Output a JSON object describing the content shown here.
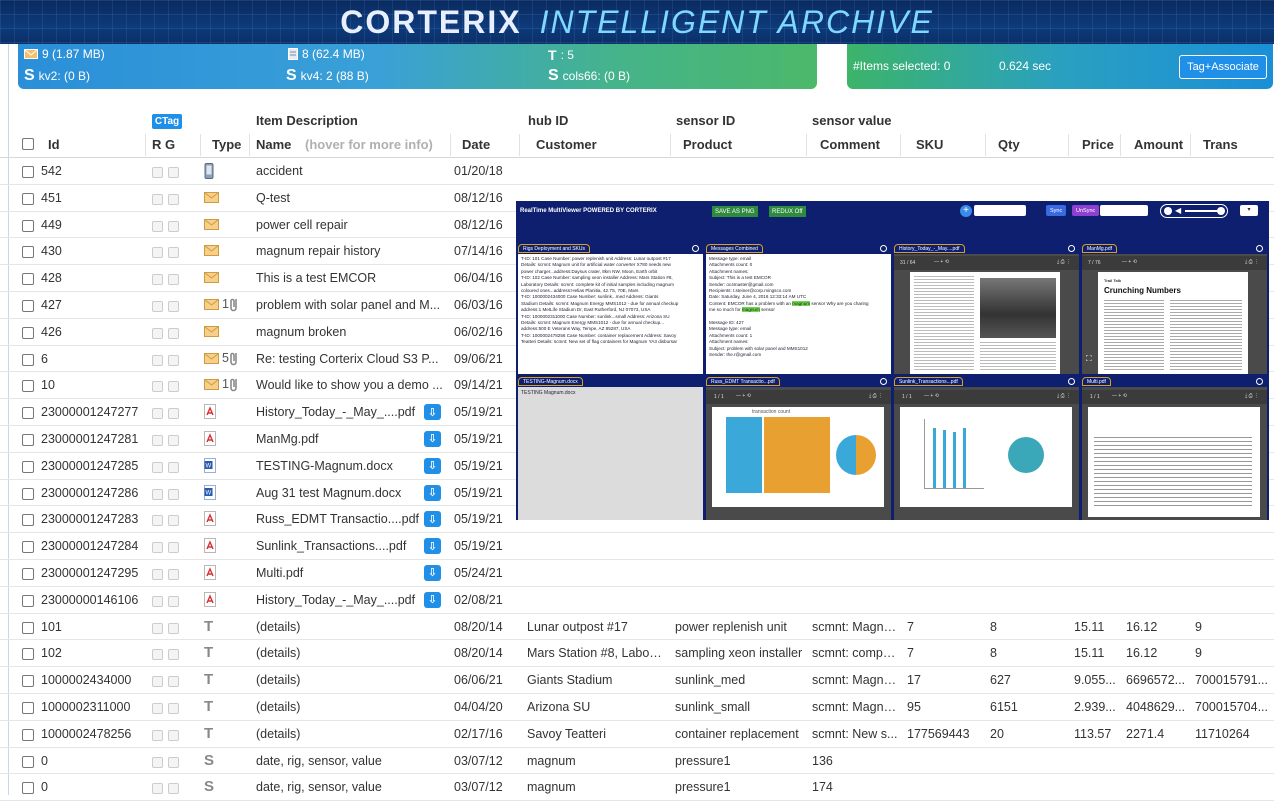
{
  "banner": {
    "title_main": "CORTERIX",
    "title_sub": "INTELLIGENT ARCHIVE"
  },
  "stats": {
    "email": "9  (1.87 MB)",
    "docs": "8  (62.4 MB)",
    "t_label": "T",
    "t_value": ": 5",
    "s_kv2_label": "kv2:  (0 B)",
    "s_kv4_label": "kv4:  2  (88 B)",
    "s_cols_label": "cols66:  (0 B)"
  },
  "selection": {
    "items_selected": "#Items selected:  0",
    "duration": "0.624 sec",
    "tag_button": "Tag+Associate"
  },
  "columns": {
    "ctag": "CTag",
    "item_description": "Item Description",
    "hub_id": "hub ID",
    "sensor_id": "sensor ID",
    "sensor_value": "sensor value",
    "id": "Id",
    "rg": "R G",
    "type": "Type",
    "name": "Name",
    "name_hint": "(hover for more info)",
    "date": "Date",
    "customer": "Customer",
    "product": "Product",
    "comment": "Comment",
    "sku": "SKU",
    "qty": "Qty",
    "price": "Price",
    "amount": "Amount",
    "trans": "Trans"
  },
  "rows": [
    {
      "id": "542",
      "type": "phone",
      "name": "accident",
      "date": "01/20/18"
    },
    {
      "id": "451",
      "type": "email",
      "name": "Q-test",
      "date": "08/12/16"
    },
    {
      "id": "449",
      "type": "email",
      "name": "power cell repair",
      "date": "08/12/16"
    },
    {
      "id": "430",
      "type": "email",
      "name": "magnum repair history",
      "date": "07/14/16"
    },
    {
      "id": "428",
      "type": "email",
      "name": "This is a test EMCOR",
      "date": "06/04/16"
    },
    {
      "id": "427",
      "type": "email",
      "att": "1",
      "name": "problem with solar panel and M...",
      "date": "06/03/16"
    },
    {
      "id": "426",
      "type": "email",
      "name": "magnum broken",
      "date": "06/02/16"
    },
    {
      "id": "6",
      "type": "email",
      "att": "5",
      "name": "Re: testing Corterix Cloud S3 P...",
      "date": "09/06/21"
    },
    {
      "id": "10",
      "type": "email",
      "att": "1",
      "name": "Would like to show you a demo ...",
      "date": "09/14/21"
    },
    {
      "id": "23000001247277",
      "type": "pdf",
      "name": "History_Today_-_May_....pdf",
      "date": "05/19/21",
      "dl": true
    },
    {
      "id": "23000001247281",
      "type": "pdf",
      "name": "ManMg.pdf",
      "date": "05/19/21",
      "dl": true
    },
    {
      "id": "23000001247285",
      "type": "word",
      "name": "TESTING-Magnum.docx",
      "date": "05/19/21",
      "dl": true
    },
    {
      "id": "23000001247286",
      "type": "word",
      "name": "Aug 31 test Magnum.docx",
      "date": "05/19/21",
      "dl": true
    },
    {
      "id": "23000001247283",
      "type": "pdf",
      "name": "Russ_EDMT Transactio....pdf",
      "date": "05/19/21",
      "dl": true
    },
    {
      "id": "23000001247284",
      "type": "pdf",
      "name": "Sunlink_Transactions....pdf",
      "date": "05/19/21",
      "dl": true
    },
    {
      "id": "23000001247295",
      "type": "pdf",
      "name": "Multi.pdf",
      "date": "05/24/21",
      "dl": true
    },
    {
      "id": "23000000146106",
      "type": "pdf",
      "name": "History_Today_-_May_....pdf",
      "date": "02/08/21",
      "dl": true
    },
    {
      "id": "101",
      "type": "T",
      "name": "(details)",
      "date": "08/20/14",
      "customer": "Lunar outpost #17",
      "product": "power replenish unit",
      "comment": "scmnt: Magnu...",
      "sku": "7",
      "qty": "8",
      "price": "15.11",
      "amount": "16.12",
      "trans": "9"
    },
    {
      "id": "102",
      "type": "T",
      "name": "(details)",
      "date": "08/20/14",
      "customer": "Mars Station #8, Laborat...",
      "product": "sampling xeon installer",
      "comment": "scmnt: comple...",
      "sku": "7",
      "qty": "8",
      "price": "15.11",
      "amount": "16.12",
      "trans": "9"
    },
    {
      "id": "1000002434000",
      "type": "T",
      "name": "(details)",
      "date": "06/06/21",
      "customer": "Giants Stadium",
      "product": "sunlink_med",
      "comment": "scmnt: Magnu...",
      "sku": "17",
      "qty": "627",
      "price": "9.055...",
      "amount": "6696572...",
      "trans": "700015791..."
    },
    {
      "id": "1000002311000",
      "type": "T",
      "name": "(details)",
      "date": "04/04/20",
      "customer": "Arizona SU",
      "product": "sunlink_small",
      "comment": "scmnt: Magnu...",
      "sku": "95",
      "qty": "6151",
      "price": "2.939...",
      "amount": "4048629...",
      "trans": "700015704..."
    },
    {
      "id": "1000002478256",
      "type": "T",
      "name": "(details)",
      "date": "02/17/16",
      "customer": "Savoy Teatteri",
      "product": "container replacement",
      "comment": "scmnt: New s...",
      "sku": "177569443",
      "qty": "20",
      "price": "113.57",
      "amount": "2271.4",
      "trans": "11710264"
    },
    {
      "id": "0",
      "type": "S",
      "name": "date, rig, sensor, value",
      "date": "03/07/12",
      "customer": "magnum",
      "product": "pressure1",
      "comment": "136"
    },
    {
      "id": "0",
      "type": "S",
      "name": "date, rig, sensor, value",
      "date": "03/07/12",
      "customer": "magnum",
      "product": "pressure1",
      "comment": "174"
    }
  ],
  "viewer": {
    "app_title": "RealTime MultiViewer   POWERED BY CORTERIX",
    "save_png": "SAVE AS PNG",
    "redux": "REDUX Off",
    "sync": "Sync",
    "unsync": "UnSync",
    "panels": {
      "rigs": "Rigs Deployment and SKUs",
      "messages": "Messages Combined",
      "history": "History_Today_-_May....pdf",
      "manmg": "ManMg.pdf",
      "testing": "TESTING-Magnum.docx",
      "russ": "Russ_EDMT Transactio...pdf",
      "sunlink": "Sunlink_Transactions...pdf",
      "multi": "Multi.pdf"
    },
    "history_page": "31 / 64",
    "manmg_page": "7 / 76",
    "russ_page": "1 / 1",
    "sunlink_page": "1 / 1",
    "multi_page": "1 / 1",
    "crunching": "Crunching Numbers",
    "trail_talk": "Trail Talk",
    "testing_text": "TESTING Magnum.docx",
    "transaction_count": "transaction count"
  }
}
